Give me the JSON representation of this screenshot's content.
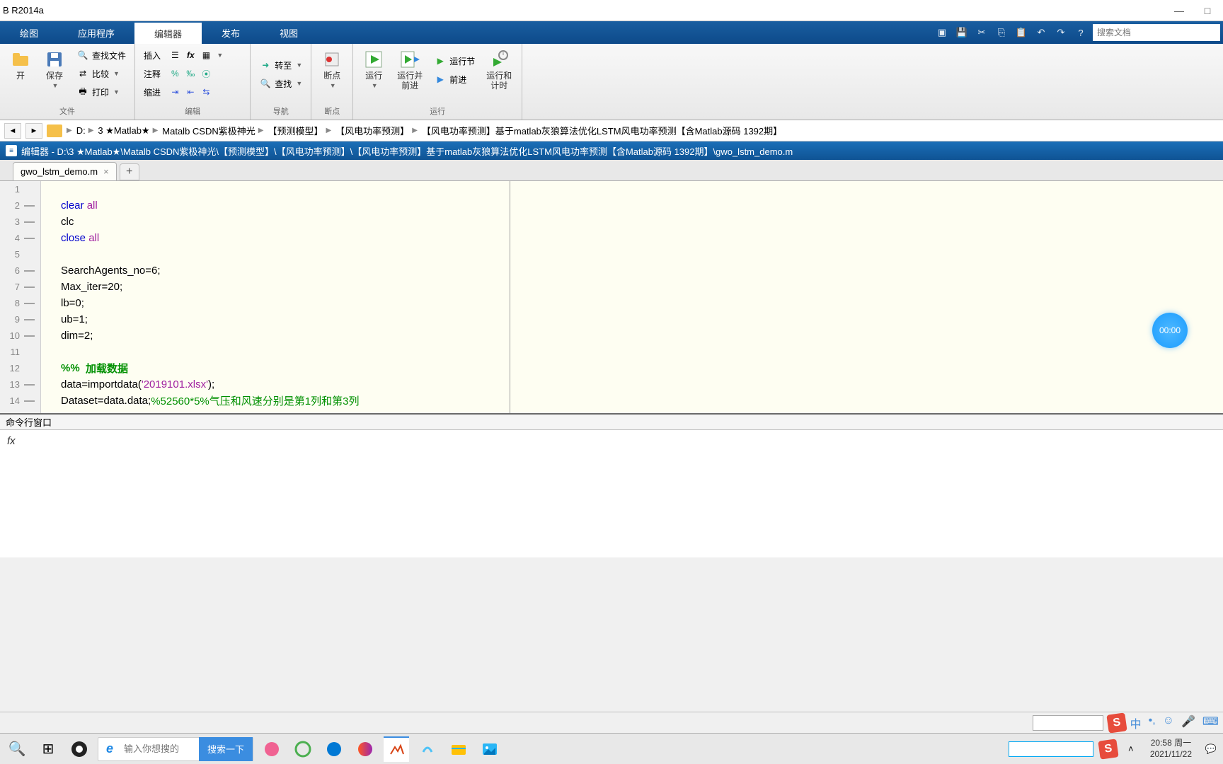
{
  "window": {
    "title": "B R2014a"
  },
  "tabs": {
    "plot": "绘图",
    "apps": "应用程序",
    "editor": "编辑器",
    "publish": "发布",
    "view": "视图"
  },
  "search_docs_placeholder": "搜索文档",
  "ribbon": {
    "file_group": "文件",
    "edit_group": "编辑",
    "nav_group": "导航",
    "bp_group": "断点",
    "run_group": "运行",
    "open": "开",
    "save": "保存",
    "find_files": "查找文件",
    "compare": "比较",
    "print": "打印",
    "insert": "插入",
    "comment": "注释",
    "indent": "缩进",
    "fx": "fx",
    "goto": "转至",
    "find": "查找",
    "breakpoints": "断点",
    "run": "运行",
    "run_advance": "运行并\n前进",
    "run_section": "运行节",
    "advance": "前进",
    "run_time": "运行和\n计时"
  },
  "breadcrumb": [
    "D:",
    "3 ★Matlab★",
    "Matalb CSDN紫极神光",
    "【预测模型】",
    "【风电功率预测】",
    "【风电功率预测】基于matlab灰狼算法优化LSTM风电功率预测【含Matlab源码 1392期】"
  ],
  "editor_title": "编辑器 - D:\\3 ★Matlab★\\Matalb CSDN紫极神光\\【预测模型】\\【风电功率预测】\\【风电功率预测】基于matlab灰狼算法优化LSTM风电功率预测【含Matlab源码 1392期】\\gwo_lstm_demo.m",
  "file_tab": "gwo_lstm_demo.m",
  "code": {
    "l2a": "clear ",
    "l2b": "all",
    "l3": "clc",
    "l4a": "close ",
    "l4b": "all",
    "l6": "SearchAgents_no=6;",
    "l7": "Max_iter=20;",
    "l8": "lb=0;",
    "l9": "ub=1;",
    "l10": "dim=2;",
    "l12a": "%%  ",
    "l12b": "加载数据",
    "l13a": "data=importdata(",
    "l13b": "'2019101.xlsx'",
    "l13c": ");",
    "l14a": "Dataset=data.data;",
    "l14b": "%52560*5%气压和风速分别是第1列和第3列"
  },
  "timer": "00:00",
  "cmd_title": "命令行窗口",
  "cmd_prompt": "fx",
  "taskbar": {
    "search_placeholder": "输入你想搜的",
    "search_btn": "搜索一下",
    "ime": "S",
    "lang": "中",
    "time": "20:58 周一",
    "date": "2021/11/22"
  }
}
